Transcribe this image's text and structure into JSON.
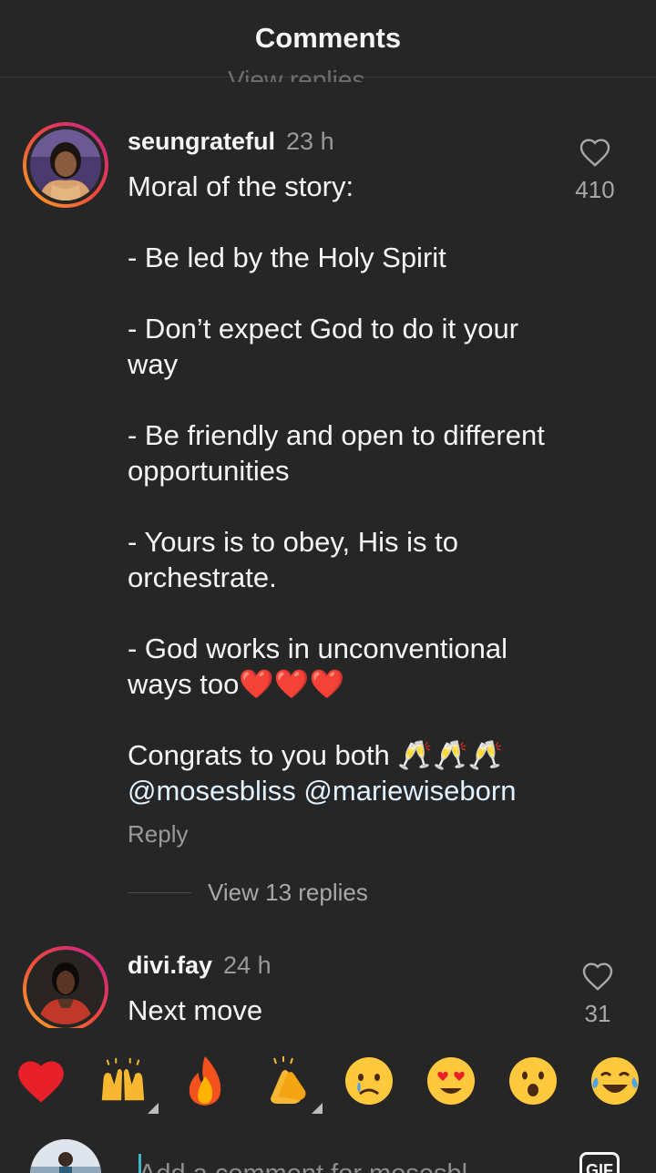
{
  "header": {
    "title": "Comments"
  },
  "partial_text": "View replies",
  "comments": [
    {
      "username": "seungrateful",
      "time": "23 h",
      "lines": [
        "Moral of the story:",
        "",
        "- Be led by the Holy Spirit",
        "",
        "- Don’t expect God to do it your way",
        "",
        "- Be  friendly and open to different opportunities",
        "",
        "- Yours is to obey, His is to orchestrate.",
        "",
        "- God works in unconventional ways too❤️❤️❤️",
        "",
        "Congrats to you both 🥂🥂🥂"
      ],
      "mentions": [
        "@mosesbliss",
        "@mariewiseborn"
      ],
      "likes": "410",
      "reply_label": "Reply",
      "view_replies": "View 13 replies"
    },
    {
      "username": "divi.fay",
      "time": "24 h",
      "text": "Next move",
      "likes": "31"
    }
  ],
  "emoji_bar": [
    "❤️",
    "🙌",
    "🔥",
    "👏",
    "😢",
    "😍",
    "😮",
    "😂"
  ],
  "composer": {
    "placeholder": "Add a comment for mosesbl...",
    "gif_label": "GIF"
  },
  "colors": {
    "background": "#262626",
    "mention": "#e0f1ff",
    "story_ring_start": "#f9a825",
    "story_ring_end": "#c21d8f"
  }
}
